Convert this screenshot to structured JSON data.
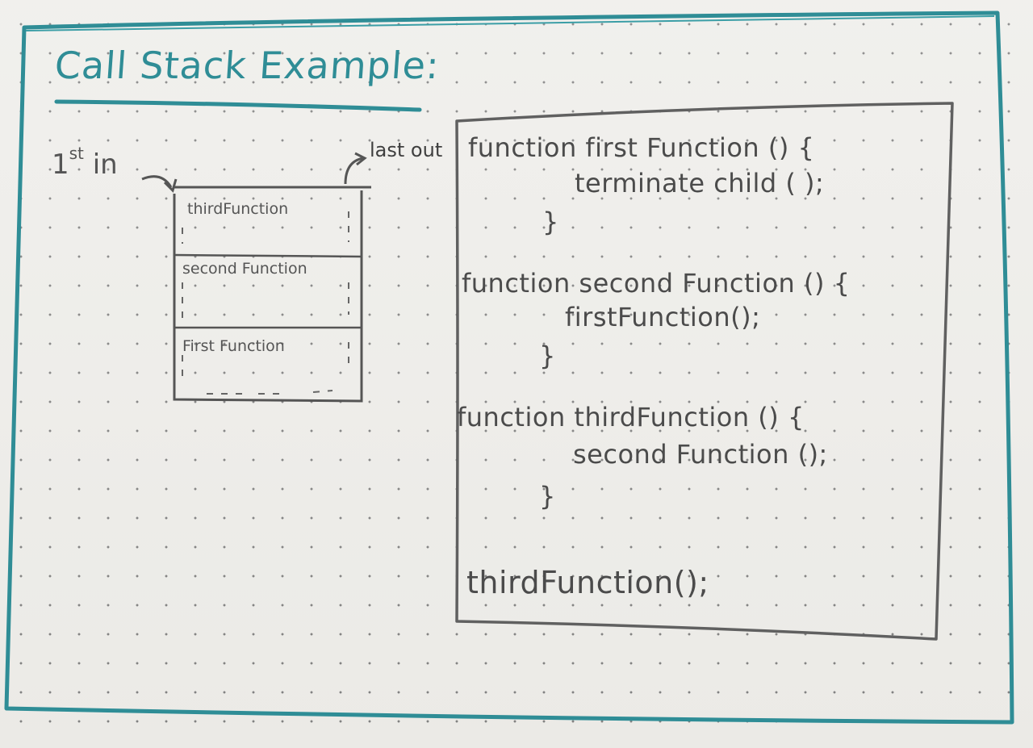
{
  "title": "Call Stack Example:",
  "labels": {
    "first_in": "1",
    "first_in_suffix": "st",
    "first_in_word": " in",
    "last_out": "last out"
  },
  "stack_frames": [
    "thirdFunction",
    "second Function",
    "First Function"
  ],
  "code": {
    "first_function_header": "function first Function () {",
    "first_function_body": "terminate child ( );",
    "first_function_close": "}",
    "second_function_header": "function second Function () {",
    "second_function_body": "firstFunction();",
    "second_function_close": "}",
    "third_function_header": "function thirdFunction () {",
    "third_function_body": "second Function ();",
    "third_function_close": "}",
    "call": "thirdFunction();"
  },
  "colors": {
    "ink_teal": "#2f8d96",
    "ink_gray": "#555555",
    "paper": "#ecebe7"
  }
}
